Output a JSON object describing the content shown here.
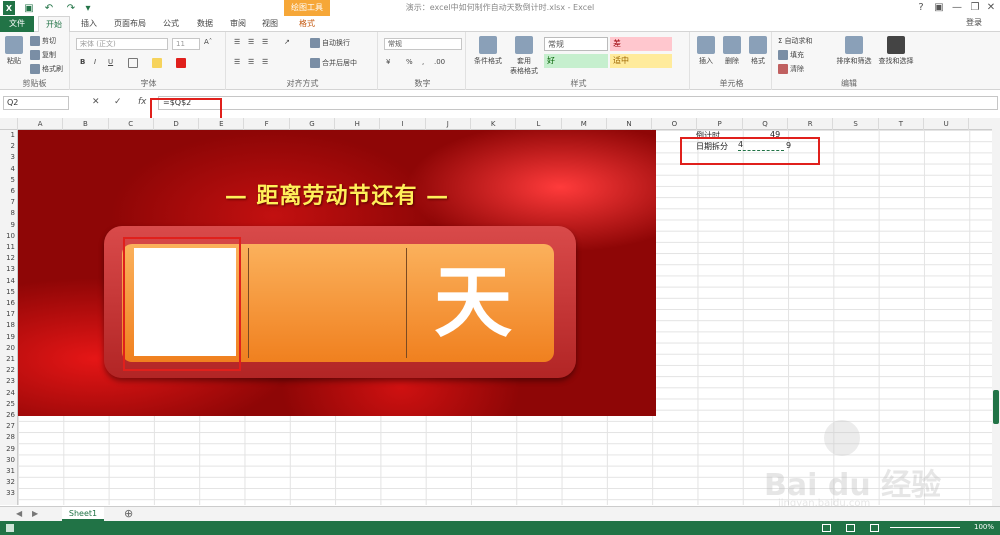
{
  "titlebar": {
    "title": "演示：excel中如何制作自动天数倒计时.xlsx - Excel",
    "drawing_tools": "绘图工具",
    "help": "?",
    "minimize": "—",
    "restore": "❐",
    "close": "✕"
  },
  "tabs": {
    "file": "文件",
    "home": "开始",
    "insert": "插入",
    "page_layout": "页面布局",
    "formulas": "公式",
    "data": "数据",
    "review": "审阅",
    "view": "视图",
    "format": "格式",
    "login": "登录"
  },
  "ribbon": {
    "clipboard": {
      "label": "剪贴板",
      "paste": "粘贴",
      "cut": "剪切",
      "copy": "复制",
      "format_painter": "格式刷"
    },
    "font": {
      "label": "字体",
      "font_name": "宋体 (正文)",
      "font_size": "11",
      "bold": "B",
      "italic": "I",
      "underline": "U"
    },
    "alignment": {
      "label": "对齐方式",
      "wrap": "自动换行",
      "merge": "合并后居中"
    },
    "number": {
      "label": "数字",
      "format": "常规",
      "percent": "%",
      "comma": ","
    },
    "styles": {
      "label": "样式",
      "conditional": "条件格式",
      "table_format_line1": "套用",
      "table_format_line2": "表格格式",
      "normal": "常规",
      "bad": "差",
      "good": "好",
      "neutral": "适中"
    },
    "cells": {
      "label": "单元格",
      "insert": "插入",
      "delete": "删除",
      "format": "格式"
    },
    "editing": {
      "label": "编辑",
      "autosum": "自动求和",
      "fill": "填充",
      "clear": "清除",
      "sort_filter": "排序和筛选",
      "find_select": "查找和选择"
    }
  },
  "formula_bar": {
    "name_box": "Q2",
    "cancel": "✕",
    "enter": "✓",
    "fx": "fx",
    "formula": "=$Q$2"
  },
  "columns": [
    "A",
    "B",
    "C",
    "D",
    "E",
    "F",
    "G",
    "H",
    "I",
    "J",
    "K",
    "L",
    "M",
    "N",
    "O",
    "P",
    "Q",
    "R",
    "S",
    "T",
    "U"
  ],
  "rows": [
    "1",
    "2",
    "3",
    "4",
    "5",
    "6",
    "7",
    "8",
    "9",
    "10",
    "11",
    "12",
    "13",
    "14",
    "15",
    "16",
    "17",
    "18",
    "19",
    "20",
    "21",
    "22",
    "23",
    "24",
    "25",
    "26",
    "27",
    "28",
    "29",
    "30",
    "31",
    "32",
    "33"
  ],
  "picture": {
    "headline": "— 距离劳动节还有 —",
    "day_char": "天"
  },
  "cells": {
    "countdown_label": "倒计时",
    "countdown_value": "49",
    "split_label": "日期拆分",
    "split_digit_1": "4",
    "split_digit_2": "9"
  },
  "sheets": {
    "active": "Sheet1",
    "add": "⊕"
  },
  "status": {
    "zoom": "100%"
  },
  "watermark": {
    "brand": "Bai du 经验",
    "url": "jingyan.baidu.com"
  },
  "colors": {
    "excel_green": "#217346",
    "highlight_red": "#e0201c",
    "counter_orange": "#f0801f"
  }
}
